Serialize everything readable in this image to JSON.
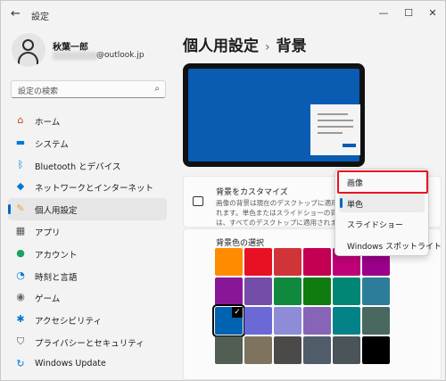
{
  "window": {
    "title": "設定",
    "back_icon": "back-arrow-icon"
  },
  "profile": {
    "name": "秋葉一郎",
    "email": "@outlook.jp"
  },
  "search": {
    "placeholder": "設定の検索"
  },
  "nav": [
    {
      "label": "ホーム",
      "icon": "home-icon",
      "color": "#c2410c"
    },
    {
      "label": "システム",
      "icon": "system-icon",
      "color": "#0078d4"
    },
    {
      "label": "Bluetooth とデバイス",
      "icon": "bluetooth-icon",
      "color": "#0078d4"
    },
    {
      "label": "ネットワークとインターネット",
      "icon": "wifi-icon",
      "color": "#0078d4"
    },
    {
      "label": "個人用設定",
      "icon": "brush-icon",
      "color": "#e8a33d",
      "active": true
    },
    {
      "label": "アプリ",
      "icon": "apps-icon",
      "color": "#555555"
    },
    {
      "label": "アカウント",
      "icon": "account-icon",
      "color": "#1aa260"
    },
    {
      "label": "時刻と言語",
      "icon": "globe-clock-icon",
      "color": "#0078d4"
    },
    {
      "label": "ゲーム",
      "icon": "gamepad-icon",
      "color": "#666666"
    },
    {
      "label": "アクセシビリティ",
      "icon": "accessibility-icon",
      "color": "#0078d4"
    },
    {
      "label": "プライバシーとセキュリティ",
      "icon": "shield-icon",
      "color": "#555555"
    },
    {
      "label": "Windows Update",
      "icon": "update-icon",
      "color": "#0078d4"
    }
  ],
  "breadcrumb": {
    "parent": "個人用設定",
    "separator": "›",
    "current": "背景"
  },
  "customize": {
    "title": "背景をカスタマイズ",
    "description": "画像の背景は現在のデスクトップに適用されます。単色またはスライドショーの背景は、すべてのデスクトップに適用されます。"
  },
  "colors_section": {
    "title": "背景色の選択",
    "selected_index": 12,
    "swatches": [
      "#ff8c00",
      "#e81123",
      "#d13438",
      "#c30052",
      "#bf0077",
      "#9a0089",
      "#881798",
      "#744da9",
      "#10893e",
      "#107c10",
      "#018574",
      "#2d7d9a",
      "#0063b1",
      "#6b69d6",
      "#8e8cd8",
      "#8764b8",
      "#038387",
      "#486860",
      "#525e54",
      "#7e735f",
      "#4c4a48",
      "#515c6b",
      "#4a5459",
      "#000000"
    ]
  },
  "dropdown": {
    "options": [
      "画像",
      "単色",
      "スライドショー",
      "Windows スポットライト"
    ],
    "selected": "単色",
    "highlighted": "画像"
  }
}
